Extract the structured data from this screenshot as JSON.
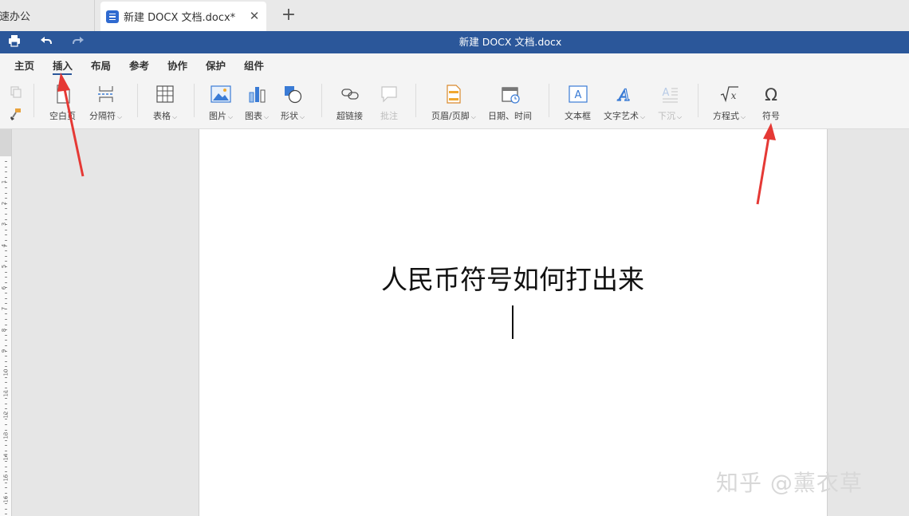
{
  "tabs": {
    "inactive_label": "极速办公",
    "active_label": "新建 DOCX 文档.docx*",
    "close_glyph": "✕",
    "new_glyph": "+"
  },
  "titlebar": {
    "title": "新建 DOCX 文档.docx"
  },
  "menu": {
    "items": [
      "主页",
      "插入",
      "布局",
      "参考",
      "协作",
      "保护",
      "组件"
    ],
    "active": "插入"
  },
  "ribbon": {
    "blank_page": "空白页",
    "page_break": "分隔符",
    "table": "表格",
    "picture": "图片",
    "chart": "图表",
    "shape": "形状",
    "hyperlink": "超链接",
    "comment": "批注",
    "header_footer": "页眉/页脚",
    "date_time": "日期、时间",
    "textbox": "文本框",
    "text_art": "文字艺术",
    "drop_cap": "下沉",
    "equation": "方程式",
    "symbol": "符号"
  },
  "document": {
    "title_text": "人民币符号如何打出来"
  },
  "ruler_numbers": [
    "1",
    "2",
    "3",
    "4",
    "5",
    "6",
    "7",
    "8",
    "9",
    "10",
    "11",
    "12",
    "13",
    "14",
    "15",
    "16"
  ],
  "watermark": "知乎 @薰衣草",
  "colors": {
    "titlebar": "#2b579a",
    "arrow": "#e53935",
    "accent": "#2f6ad0"
  }
}
